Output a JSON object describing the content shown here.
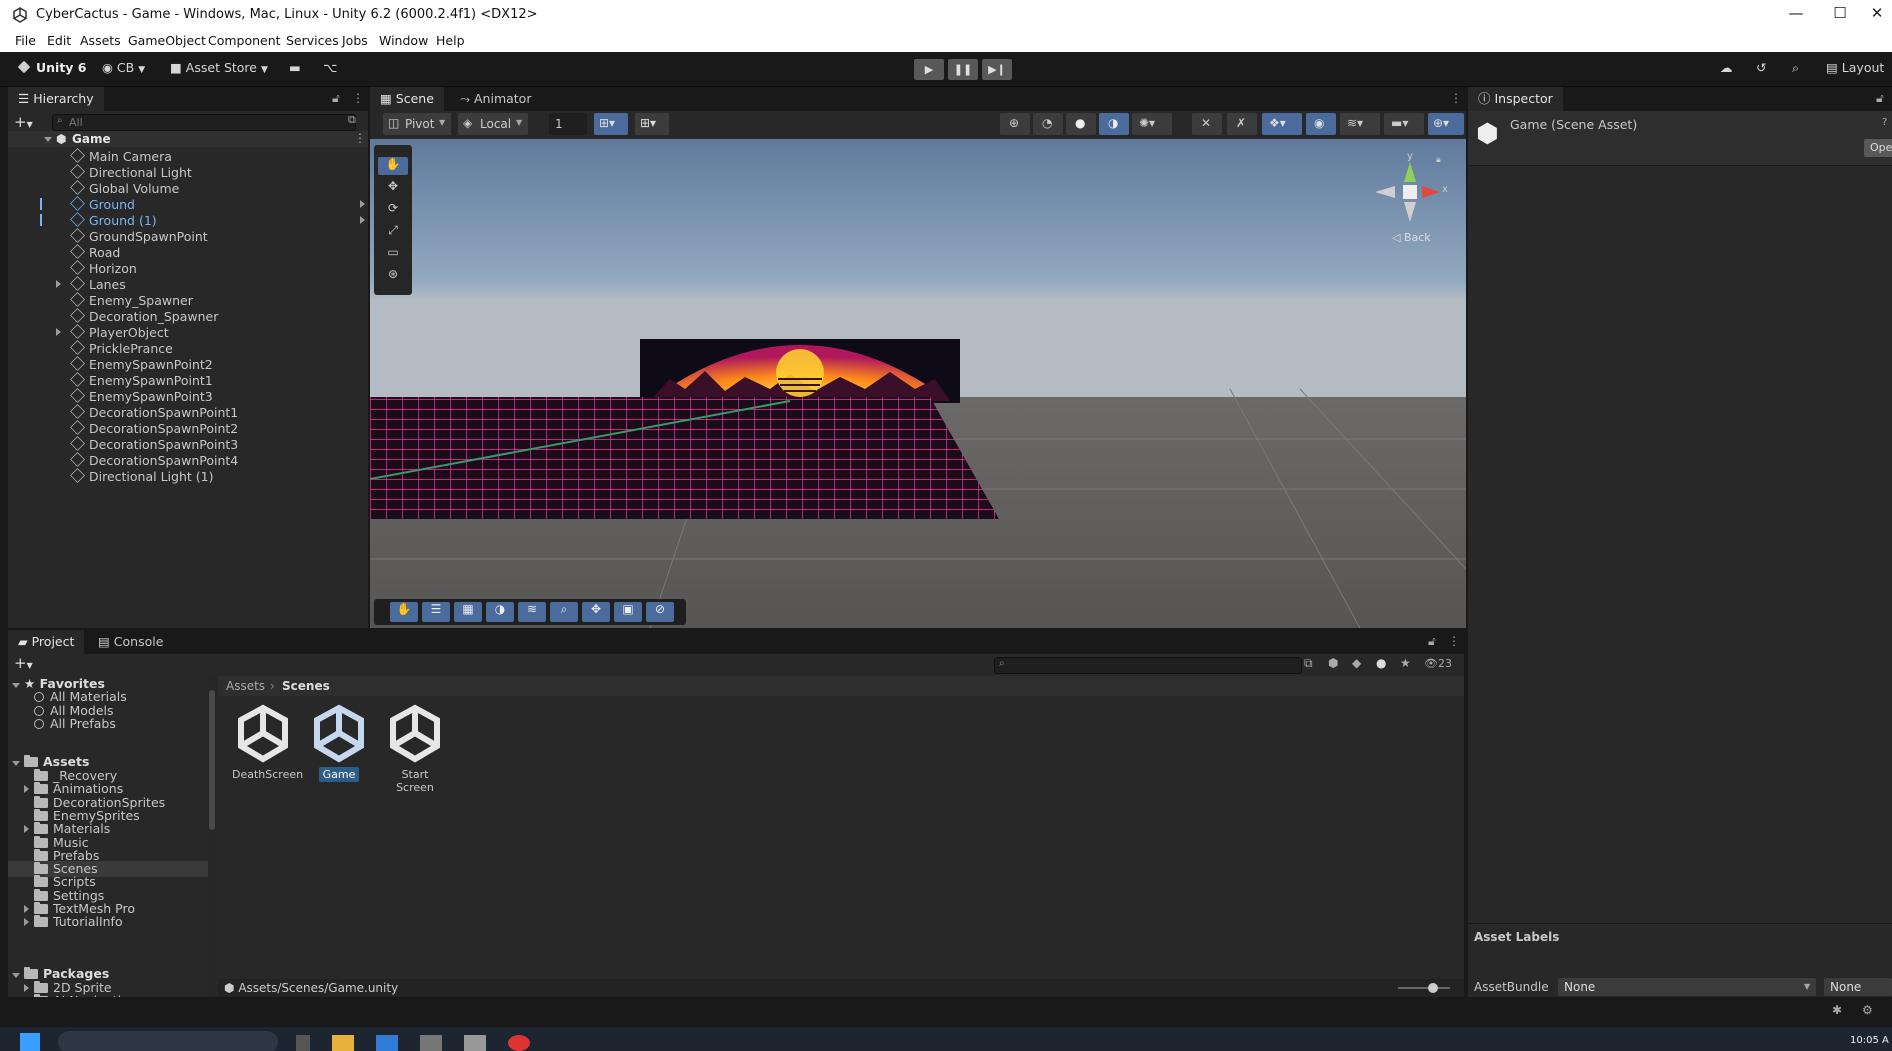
{
  "window": {
    "title": "CyberCactus - Game - Windows, Mac, Linux - Unity 6.2 (6000.2.4f1) <DX12>",
    "min": "—",
    "max": "☐",
    "close": "✕"
  },
  "menu": [
    "File",
    "Edit",
    "Assets",
    "GameObject",
    "Component",
    "Services",
    "Jobs",
    "Window",
    "Help"
  ],
  "toolbar": {
    "unity": "Unity 6",
    "account": "CB",
    "asset_store": "Asset Store",
    "layout": "Layout"
  },
  "hierarchy": {
    "tab": "Hierarchy",
    "search_placeholder": "All",
    "root": "Game",
    "items": [
      {
        "label": "Main Camera"
      },
      {
        "label": "Directional Light"
      },
      {
        "label": "Global Volume"
      },
      {
        "label": "Ground",
        "selected": true
      },
      {
        "label": "Ground (1)",
        "selected": true
      },
      {
        "label": "GroundSpawnPoint"
      },
      {
        "label": "Road"
      },
      {
        "label": "Horizon"
      },
      {
        "label": "Lanes",
        "expandable": true
      },
      {
        "label": "Enemy_Spawner"
      },
      {
        "label": "Decoration_Spawner"
      },
      {
        "label": "PlayerObject",
        "expandable": true
      },
      {
        "label": "PricklePrance"
      },
      {
        "label": "EnemySpawnPoint2"
      },
      {
        "label": "EnemySpawnPoint1"
      },
      {
        "label": "EnemySpawnPoint3"
      },
      {
        "label": "DecorationSpawnPoint1"
      },
      {
        "label": "DecorationSpawnPoint2"
      },
      {
        "label": "DecorationSpawnPoint3"
      },
      {
        "label": "DecorationSpawnPoint4"
      },
      {
        "label": "Directional Light (1)"
      }
    ]
  },
  "scene": {
    "tabs": [
      "Scene",
      "Animator"
    ],
    "pivot": "Pivot",
    "local": "Local",
    "grid_value": "1",
    "gizmo_y": "y",
    "gizmo_x": "x",
    "gizmo_view": "Back"
  },
  "inspector": {
    "tab": "Inspector",
    "object": "Game (Scene Asset)",
    "open_btn": "Ope",
    "asset_labels": "Asset Labels",
    "assetbundle_label": "AssetBundle",
    "assetbundle_value": "None",
    "variant_value": "None"
  },
  "project": {
    "tabs": [
      "Project",
      "Console"
    ],
    "favorites_title": "Favorites",
    "favorites": [
      "All Materials",
      "All Models",
      "All Prefabs"
    ],
    "assets_title": "Assets",
    "asset_folders": [
      {
        "label": "_Recovery"
      },
      {
        "label": "Animations",
        "expandable": true
      },
      {
        "label": "DecorationSprites"
      },
      {
        "label": "EnemySprites"
      },
      {
        "label": "Materials",
        "expandable": true
      },
      {
        "label": "Music"
      },
      {
        "label": "Prefabs"
      },
      {
        "label": "Scenes",
        "selected": true
      },
      {
        "label": "Scripts"
      },
      {
        "label": "Settings"
      },
      {
        "label": "TextMesh Pro",
        "expandable": true
      },
      {
        "label": "TutorialInfo",
        "expandable": true
      }
    ],
    "packages_title": "Packages",
    "package_items": [
      "2D Sprite",
      "AI Navigation"
    ],
    "breadcrumb": [
      "Assets",
      "Scenes"
    ],
    "hidden_count": "23",
    "assets": [
      {
        "label": "DeathScreen"
      },
      {
        "label": "Game",
        "selected": true
      },
      {
        "label": "Start Screen"
      }
    ],
    "path": "Assets/Scenes/Game.unity"
  },
  "taskbar": {
    "time": "10:05 A"
  },
  "colors": {
    "selection_text": "#7cb4f2",
    "selection_bg": "#2c5d87",
    "panel": "#282828",
    "background": "#191919"
  }
}
